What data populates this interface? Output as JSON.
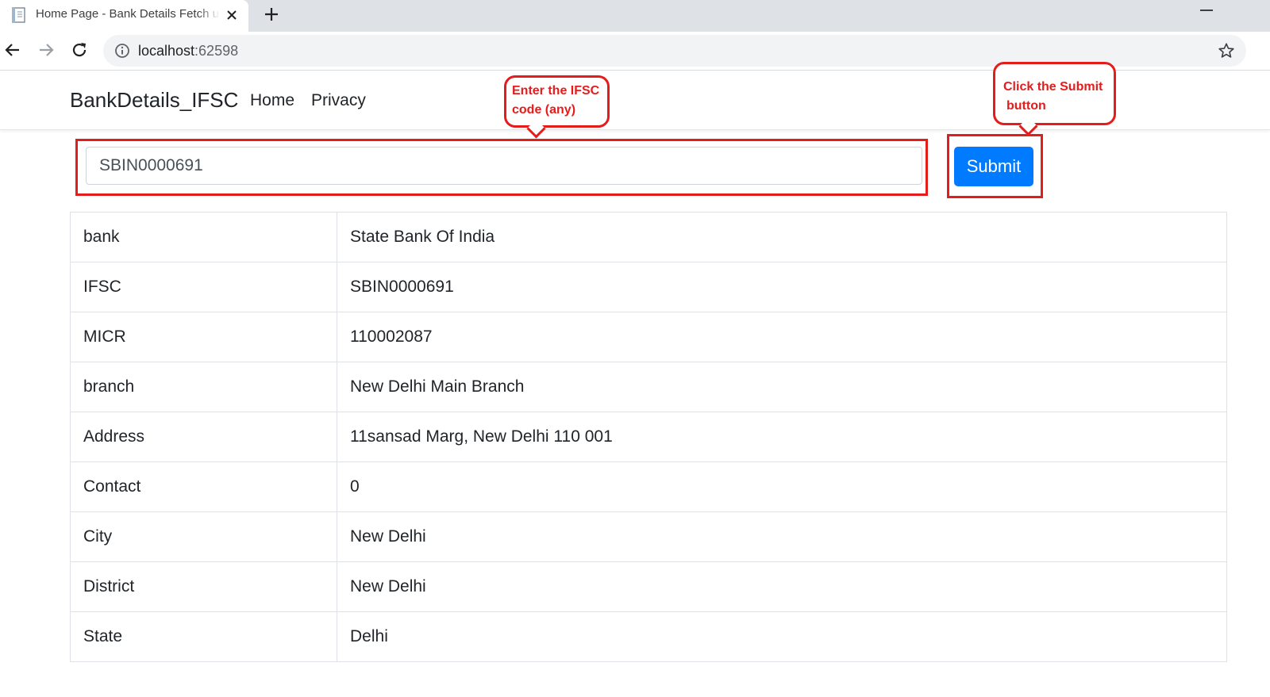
{
  "browser": {
    "tab_title": "Home Page - Bank Details Fetch using IFSC",
    "url_host": "localhost",
    "url_port": ":62598"
  },
  "navbar": {
    "brand": "BankDetails_IFSC",
    "links": [
      "Home",
      "Privacy"
    ]
  },
  "form": {
    "ifsc_value": "SBIN0000691",
    "submit_label": "Submit"
  },
  "annotations": {
    "input_callout": [
      "Enter the IFSC",
      "code (any)"
    ],
    "submit_callout": [
      "Click the Submit",
      "button"
    ],
    "color": "#e41c1c"
  },
  "details": {
    "rows": [
      {
        "key": "bank",
        "value": "State Bank Of India"
      },
      {
        "key": "IFSC",
        "value": "SBIN0000691"
      },
      {
        "key": "MICR",
        "value": "110002087"
      },
      {
        "key": "branch",
        "value": "New Delhi Main Branch"
      },
      {
        "key": "Address",
        "value": "11sansad Marg, New Delhi 110 001"
      },
      {
        "key": "Contact",
        "value": "0"
      },
      {
        "key": "City",
        "value": "New Delhi"
      },
      {
        "key": "District",
        "value": "New Delhi"
      },
      {
        "key": "State",
        "value": "Delhi"
      }
    ]
  },
  "colors": {
    "primary": "#007bff",
    "tabstrip": "#dee1e6",
    "omnibox": "#f1f3f4"
  }
}
